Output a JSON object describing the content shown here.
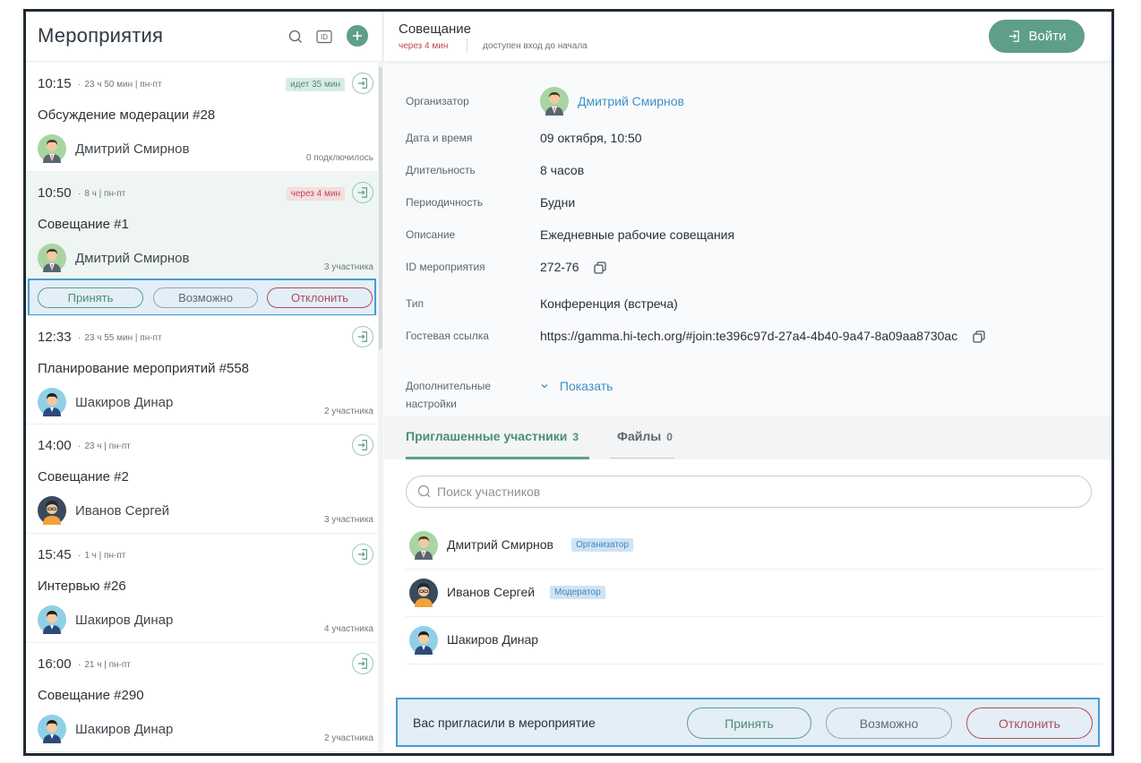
{
  "left": {
    "title": "Мероприятия",
    "id_label": "ID"
  },
  "events": [
    {
      "time": "10:15",
      "meta": "23 ч 50 мин  |  пн-пт",
      "badge": "идет 35 мин",
      "title": "Обсуждение модерации #28",
      "person": "Дмитрий Смирнов",
      "count": "0 подключилось"
    },
    {
      "time": "10:50",
      "meta": "8 ч  |  пн-пт",
      "badge": "через 4 мин",
      "title": "Совещание #1",
      "person": "Дмитрий Смирнов",
      "count": "3 участника"
    },
    {
      "time": "12:33",
      "meta": "23 ч 55 мин  |  пн-пт",
      "title": "Планирование мероприятий #558",
      "person": "Шакиров Динар",
      "count": "2 участника"
    },
    {
      "time": "14:00",
      "meta": "23 ч  |  пн-пт",
      "title": "Совещание #2",
      "person": "Иванов Сергей",
      "count": "3 участника"
    },
    {
      "time": "15:45",
      "meta": "1 ч  |  пн-пт",
      "title": "Интервью #26",
      "person": "Шакиров Динар",
      "count": "4 участника"
    },
    {
      "time": "16:00",
      "meta": "21 ч  |  пн-пт",
      "title": "Совещание #290",
      "person": "Шакиров Динар",
      "count": "2 участника"
    }
  ],
  "response_row": {
    "accept": "Принять",
    "maybe": "Возможно",
    "decline": "Отклонить"
  },
  "header": {
    "title": "Совещание",
    "starts_in": "через 4 мин",
    "access": "доступен вход до начала",
    "join": "Войти"
  },
  "details": {
    "organizer_label": "Организатор",
    "organizer": "Дмитрий Смирнов",
    "datetime_label": "Дата и время",
    "datetime": "09 октября, 10:50",
    "duration_label": "Длительность",
    "duration": "8 часов",
    "period_label": "Периодичность",
    "period": "Будни",
    "desc_label": "Описание",
    "desc": "Ежедневные рабочие совещания",
    "id_label": "ID мероприятия",
    "id": "272-76",
    "type_label": "Тип",
    "type": "Конференция (встреча)",
    "guest_label": "Гостевая ссылка",
    "guest_link": "https://gamma.hi-tech.org/#join:te396c97d-27a4-4b40-9a47-8a09aa8730ac",
    "extra_label": "Дополнительные настройки",
    "show": "Показать"
  },
  "tabs": {
    "participants": "Приглашенные участники",
    "participants_count": "3",
    "files": "Файлы",
    "files_count": "0"
  },
  "search": {
    "placeholder": "Поиск участников",
    "value": ""
  },
  "participants": [
    {
      "name": "Дмитрий Смирнов",
      "role": "Организатор"
    },
    {
      "name": "Иванов Сергей",
      "role": "Модератор"
    },
    {
      "name": "Шакиров Динар",
      "role": ""
    }
  ],
  "invite": {
    "text": "Вас пригласили в мероприятие",
    "accept": "Принять",
    "maybe": "Возможно",
    "decline": "Отклонить"
  },
  "colors": {
    "accent": "#5f9e8a",
    "danger": "#b34c58",
    "highlight": "#4b9bd6",
    "link": "#3f8fc8"
  },
  "icons": [
    "search-icon",
    "id-icon",
    "plus-icon",
    "enter-icon",
    "copy-icon",
    "chevron-down-icon",
    "avatar-icon"
  ]
}
